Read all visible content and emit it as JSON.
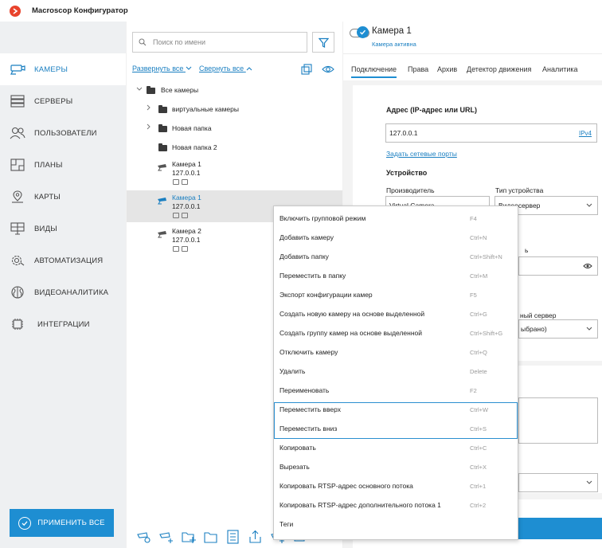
{
  "app": {
    "title": "Macroscop Конфигуратор"
  },
  "sidebar": {
    "items": [
      {
        "label": "КАМЕРЫ",
        "icon": "camera-icon",
        "active": true
      },
      {
        "label": "СЕРВЕРЫ",
        "icon": "server-icon",
        "active": false
      },
      {
        "label": "ПОЛЬЗОВАТЕЛИ",
        "icon": "users-icon",
        "active": false
      },
      {
        "label": "ПЛАНЫ",
        "icon": "plan-icon",
        "active": false
      },
      {
        "label": "КАРТЫ",
        "icon": "map-pin-icon",
        "active": false
      },
      {
        "label": "ВИДЫ",
        "icon": "monitor-icon",
        "active": false
      },
      {
        "label": "АВТОМАТИЗАЦИЯ",
        "icon": "gear-icon",
        "active": false
      },
      {
        "label": "ВИДЕОАНАЛИТИКА",
        "icon": "brain-icon",
        "active": false
      },
      {
        "label": "ИНТЕГРАЦИИ",
        "icon": "chip-icon",
        "active": false
      }
    ],
    "apply_label": "ПРИМЕНИТЬ ВСЕ"
  },
  "tree": {
    "search_placeholder": "Поиск по имени",
    "expand_all": "Развернуть все",
    "collapse_all": "Свернуть все",
    "root": "Все камеры",
    "folders": [
      "виртуальные камеры",
      "Новая папка",
      "Новая папка 2"
    ],
    "cameras": [
      {
        "name": "Камера 1",
        "ip": "127.0.0.1",
        "selected": false
      },
      {
        "name": "Камера 1",
        "ip": "127.0.0.1",
        "selected": true
      },
      {
        "name": "Камера 2",
        "ip": "127.0.0.1",
        "selected": false
      }
    ]
  },
  "properties": {
    "camera_name": "Камера 1",
    "camera_status": "Камера активна",
    "tabs": [
      "Подключение",
      "Права",
      "Архив",
      "Детектор движения",
      "Аналитика"
    ],
    "address_title": "Адрес (IP-адрес или URL)",
    "address_value": "127.0.0.1",
    "address_type": "IPv4",
    "ports_link": "Задать сетевые порты",
    "device_title": "Устройство",
    "manufacturer_label": "Производитель",
    "manufacturer_value": "Virtual Camera",
    "device_type_label": "Тип устройства",
    "device_type_value": "Видеосервер",
    "password_label_frag": "ь",
    "server_label_frag": "ный сервер",
    "server_value_frag": "ыбрано)"
  },
  "context_menu": {
    "items": [
      {
        "label": "Включить групповой режим",
        "shortcut": "F4"
      },
      {
        "label": "Добавить камеру",
        "shortcut": "Ctrl+N"
      },
      {
        "label": "Добавить папку",
        "shortcut": "Ctrl+Shift+N"
      },
      {
        "label": "Переместить в папку",
        "shortcut": "Ctrl+M"
      },
      {
        "label": "Экспорт конфигурации камер",
        "shortcut": "F5"
      },
      {
        "label": "Создать новую камеру на основе выделенной",
        "shortcut": "Ctrl+G"
      },
      {
        "label": "Создать группу камер на основе выделенной",
        "shortcut": "Ctrl+Shift+G"
      },
      {
        "label": "Отключить камеру",
        "shortcut": "Ctrl+Q"
      },
      {
        "label": "Удалить",
        "shortcut": "Delete"
      },
      {
        "label": "Переименовать",
        "shortcut": "F2"
      },
      {
        "label": "Переместить вверх",
        "shortcut": "Ctrl+W"
      },
      {
        "label": "Переместить вниз",
        "shortcut": "Ctrl+S"
      },
      {
        "label": "Копировать",
        "shortcut": "Ctrl+C"
      },
      {
        "label": "Вырезать",
        "shortcut": "Ctrl+X"
      },
      {
        "label": "Копировать RTSP-адрес основного потока",
        "shortcut": "Ctrl+1"
      },
      {
        "label": "Копировать RTSP-адрес дополнительного потока 1",
        "shortcut": "Ctrl+2"
      },
      {
        "label": "Теги",
        "shortcut": ""
      }
    ]
  },
  "colors": {
    "accent": "#1e8ed2",
    "logo": "#e8432c"
  }
}
